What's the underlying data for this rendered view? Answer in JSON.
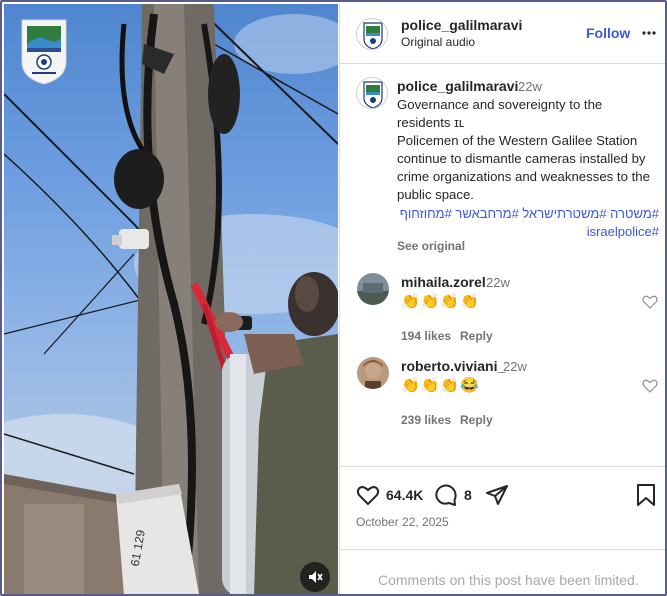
{
  "header": {
    "username": "police_galilmaravi",
    "subtitle": "Original audio",
    "follow_label": "Follow",
    "more_icon": "more-horizontal-icon"
  },
  "caption": {
    "username": "police_galilmaravi",
    "time": "22w",
    "lines": [
      "Governance and sovereignty to the residents ɪʟ",
      "Policemen of the Western Galilee Station continue to dismantle cameras installed by crime organizations and weaknesses to the public space."
    ],
    "hashtags": "#משטרה #משטרתישראל #מרחבאשר #מחוזחוף #israelpolice",
    "see_original": "See original"
  },
  "comments": [
    {
      "username": "mihaila.zorel",
      "time": "22w",
      "text": "👏👏👏👏",
      "likes": "194 likes",
      "reply": "Reply"
    },
    {
      "username": "roberto.viviani_",
      "time": "22w",
      "text": "👏👏👏😂",
      "likes": "239 likes",
      "reply": "Reply"
    }
  ],
  "actions": {
    "likes_count": "64.4K",
    "comments_count": "8",
    "date": "October 22, 2025"
  },
  "footer": {
    "limited_text": "Comments on this post have been limited."
  },
  "media": {
    "mute_icon": "speaker-muted-icon",
    "logo_icon": "police-badge-icon"
  },
  "colors": {
    "accent": "#3a5bd9",
    "muted": "#737373",
    "border": "#dbdbdb"
  }
}
